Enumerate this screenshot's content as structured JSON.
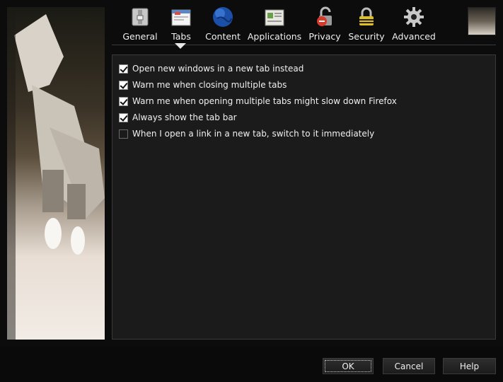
{
  "panes": [
    {
      "label": "General",
      "icon": "general-switch-icon"
    },
    {
      "label": "Tabs",
      "icon": "tabs-window-icon"
    },
    {
      "label": "Content",
      "icon": "globe-icon"
    },
    {
      "label": "Applications",
      "icon": "applications-window-icon"
    },
    {
      "label": "Privacy",
      "icon": "privacy-padlock-icon"
    },
    {
      "label": "Security",
      "icon": "security-padlock-icon"
    },
    {
      "label": "Advanced",
      "icon": "gear-icon"
    }
  ],
  "selected_pane": "Tabs",
  "options": [
    {
      "label": "Open new windows in a new tab instead",
      "checked": true
    },
    {
      "label": "Warn me when closing multiple tabs",
      "checked": true
    },
    {
      "label": "Warn me when opening multiple tabs might slow down Firefox",
      "checked": true
    },
    {
      "label": "Always show the tab bar",
      "checked": true
    },
    {
      "label": "When I open a link in a new tab, switch to it immediately",
      "checked": false
    }
  ],
  "buttons": {
    "ok": "OK",
    "cancel": "Cancel",
    "help": "Help"
  }
}
